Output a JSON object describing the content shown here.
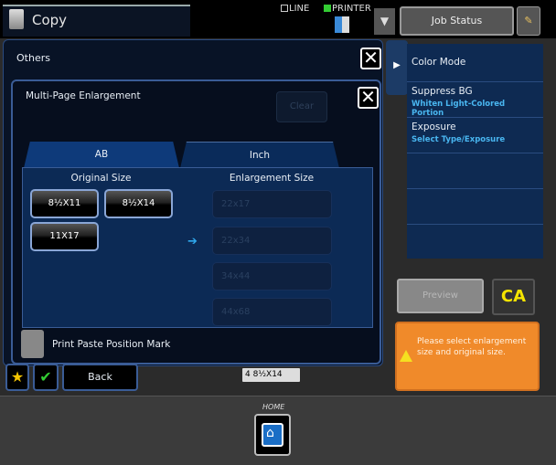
{
  "header": {
    "app_title": "Copy",
    "line_label": "LINE",
    "printer_label": "PRINTER",
    "job_status_label": "Job Status"
  },
  "right_panel": {
    "items": [
      {
        "title": "Color Mode",
        "subtitle": ""
      },
      {
        "title": "Suppress BG",
        "subtitle": "Whiten Light-Colored Portion"
      },
      {
        "title": "Exposure",
        "subtitle": "Select Type/Exposure"
      }
    ],
    "preview_label": "Preview",
    "ca_label": "CA",
    "message": "Please select enlargement size and original size."
  },
  "others": {
    "title": "Others"
  },
  "dialog": {
    "title": "Multi-Page Enlargement",
    "clear_label": "Clear",
    "tabs": [
      {
        "label": "AB",
        "selected": false
      },
      {
        "label": "Inch",
        "selected": true
      }
    ],
    "original_size_header": "Original Size",
    "enlargement_size_header": "Enlargement Size",
    "original_sizes": [
      "8½X11",
      "8½X14",
      "11X17"
    ],
    "enlargement_sizes": [
      "22x17",
      "22x34",
      "34x44",
      "44x68"
    ],
    "print_paste_label": "Print Paste Position Mark",
    "print_paste_checked": false
  },
  "bottom_bar": {
    "back_label": "Back",
    "tray_label": "4  8½X14"
  },
  "home": {
    "label": "HOME"
  },
  "colors": {
    "accent": "#0e3a7a",
    "message_bg": "#f08a2a",
    "ca": "#f5e400"
  }
}
